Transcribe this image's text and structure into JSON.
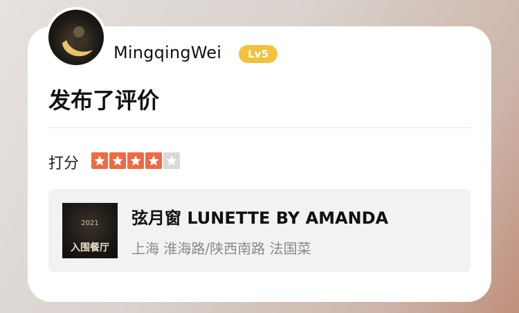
{
  "user": {
    "name": "MingqingWei",
    "level": "Lv5"
  },
  "post": {
    "action": "发布了评价"
  },
  "rating": {
    "label": "打分",
    "stars_filled": 4,
    "stars_total": 5
  },
  "restaurant": {
    "name": "弦月窗 LUNETTE BY AMANDA",
    "meta": "上海 淮海路/陕西南路 法国菜",
    "badge_year": "2021",
    "badge_text": "入围餐厅"
  },
  "colors": {
    "star_on": "#ee6a45",
    "star_off": "#d9d9d9",
    "level_badge": "#f2c23d"
  }
}
